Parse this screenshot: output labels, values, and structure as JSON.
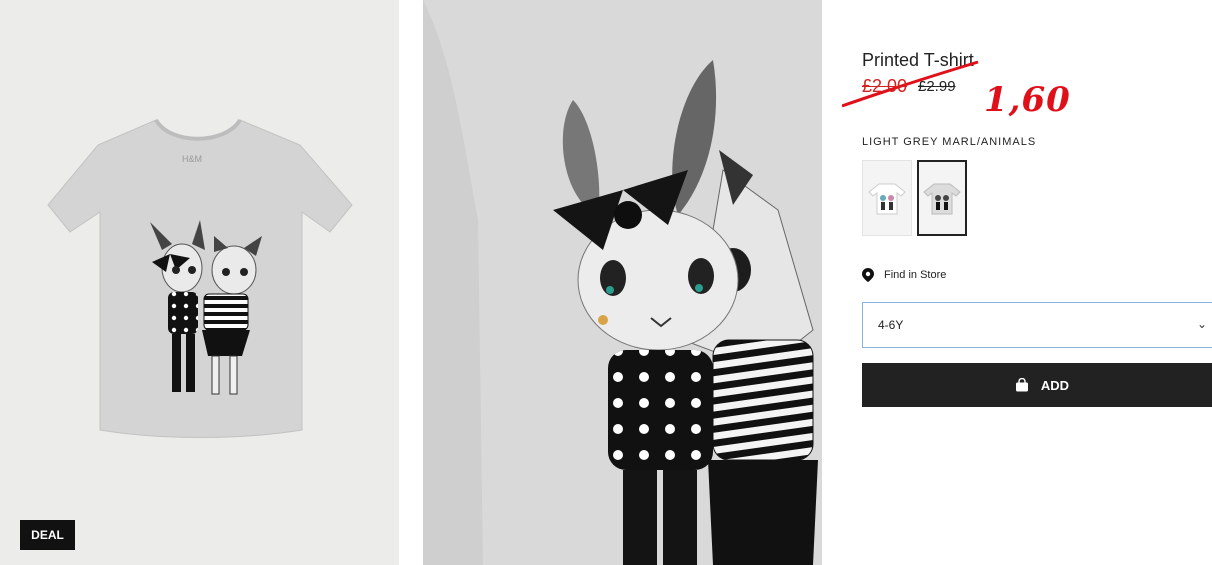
{
  "product": {
    "title": "Printed T-shirt",
    "sale_price": "£2.00",
    "regular_price": "£2.99",
    "handwritten_price": "1,60",
    "badge": "DEAL",
    "color_name": "LIGHT GREY MARL/ANIMALS",
    "swatches": [
      {
        "name": "white-animals"
      },
      {
        "name": "light-grey-marl-animals",
        "selected": true
      }
    ]
  },
  "store": {
    "label": "Find in Store",
    "icon": "map-pin-icon"
  },
  "size_select": {
    "value": "4-6Y"
  },
  "add_button": {
    "label": "ADD",
    "icon": "shopping-bag-icon"
  },
  "colors": {
    "accent_red": "#e0101a",
    "button_bg": "#222222",
    "select_border": "#8ab2e0"
  }
}
